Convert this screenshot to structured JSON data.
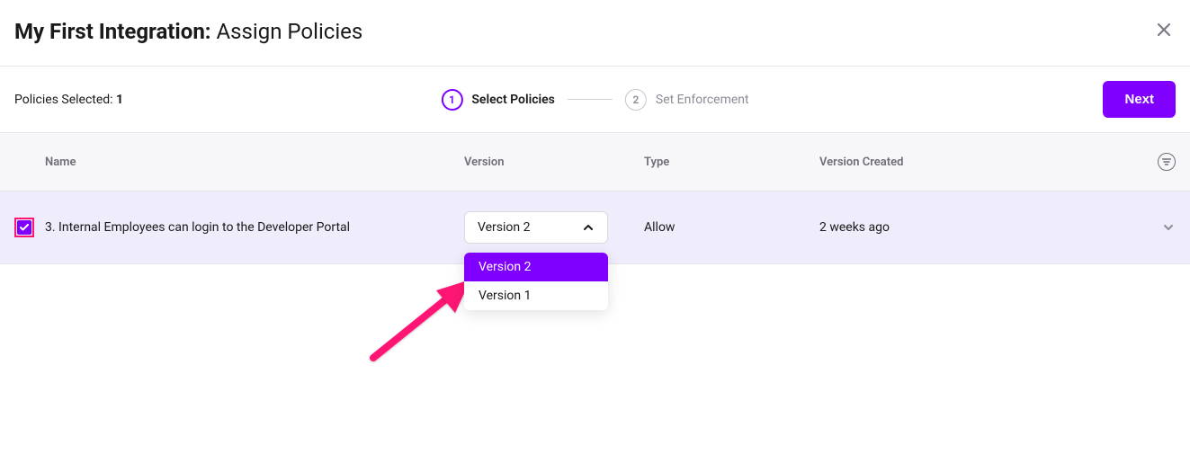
{
  "header": {
    "title_prefix": "My First Integration:",
    "title_suffix": " Assign Policies"
  },
  "toolbar": {
    "selected_label": "Policies Selected: ",
    "selected_count": "1",
    "next_label": "Next"
  },
  "stepper": {
    "step1": {
      "num": "1",
      "label": "Select Policies"
    },
    "step2": {
      "num": "2",
      "label": "Set Enforcement"
    }
  },
  "table": {
    "headers": {
      "name": "Name",
      "version": "Version",
      "type": "Type",
      "created": "Version Created"
    },
    "row": {
      "name": "3. Internal Employees can login to the Developer Portal",
      "type": "Allow",
      "created": "2 weeks ago"
    }
  },
  "version_select": {
    "selected": "Version 2",
    "options": [
      "Version 2",
      "Version 1"
    ]
  }
}
